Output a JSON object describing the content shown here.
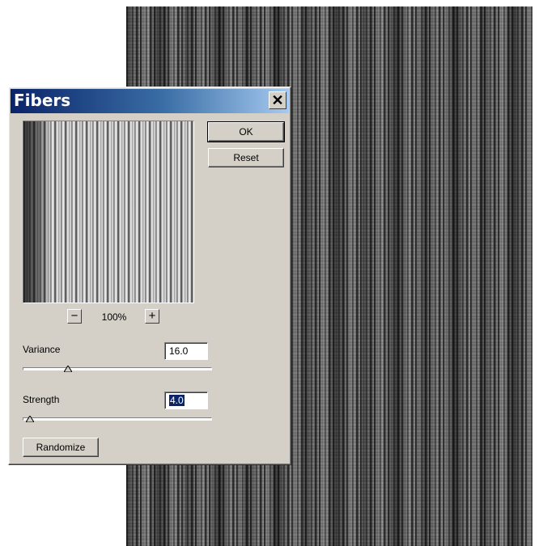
{
  "dialog": {
    "title": "Fibers",
    "close_symbol": "✕",
    "zoom_out_symbol": "−",
    "zoom_in_symbol": "+",
    "zoom_level": "100%",
    "ok_label": "OK",
    "reset_label": "Reset",
    "randomize_label": "Randomize",
    "variance": {
      "label": "Variance",
      "value": "16.0",
      "slider_fraction": 0.24
    },
    "strength": {
      "label": "Strength",
      "value": "4.0",
      "slider_fraction": 0.04
    }
  },
  "colors": {
    "dialog_bg": "#d4d0c8",
    "title_start": "#0a246a",
    "title_end": "#a6caf0",
    "selection": "#0a246a"
  }
}
